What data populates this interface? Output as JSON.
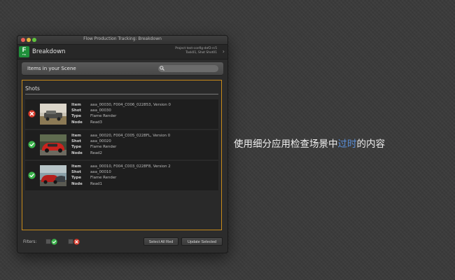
{
  "window": {
    "title": "Flow Production Tracking: Breakdown",
    "app_name": "Breakdown",
    "logo_letter": "F",
    "logo_sub": "FTR",
    "context_line1": "Project test-config-def2-rc5",
    "context_line2": "Task01, Shot Shot01"
  },
  "search": {
    "label": "Items in your Scene",
    "placeholder": ""
  },
  "shots": {
    "title": "Shots",
    "field_labels": [
      "Item",
      "Shot",
      "Type",
      "Node"
    ],
    "rows": [
      {
        "status": "out-of-date",
        "item": "aaa_00030, F004_C006_022853, Version 0",
        "shot": "aaa_00030",
        "type": "Flame Render",
        "node": "Read3"
      },
      {
        "status": "up-to-date",
        "item": "aaa_00020, F004_C005_0228FL, Version 0",
        "shot": "aaa_00020",
        "type": "Flame Render",
        "node": "Read2"
      },
      {
        "status": "up-to-date",
        "item": "aaa_00010, F004_C003_0228F8, Version 2",
        "shot": "aaa_00010",
        "type": "Flame Render",
        "node": "Read1"
      }
    ]
  },
  "footer": {
    "filters_label": "Filters:",
    "select_all_red": "Select All Red",
    "update_selected": "Update Selected"
  },
  "caption": {
    "before": "使用细分应用检查场景中",
    "highlight": "过时",
    "after": "的内容"
  },
  "colors": {
    "accent_border": "#c88a1a",
    "ok_green": "#3ab34a",
    "error_red": "#d93a2b",
    "highlight_blue": "#5a8fd8"
  }
}
